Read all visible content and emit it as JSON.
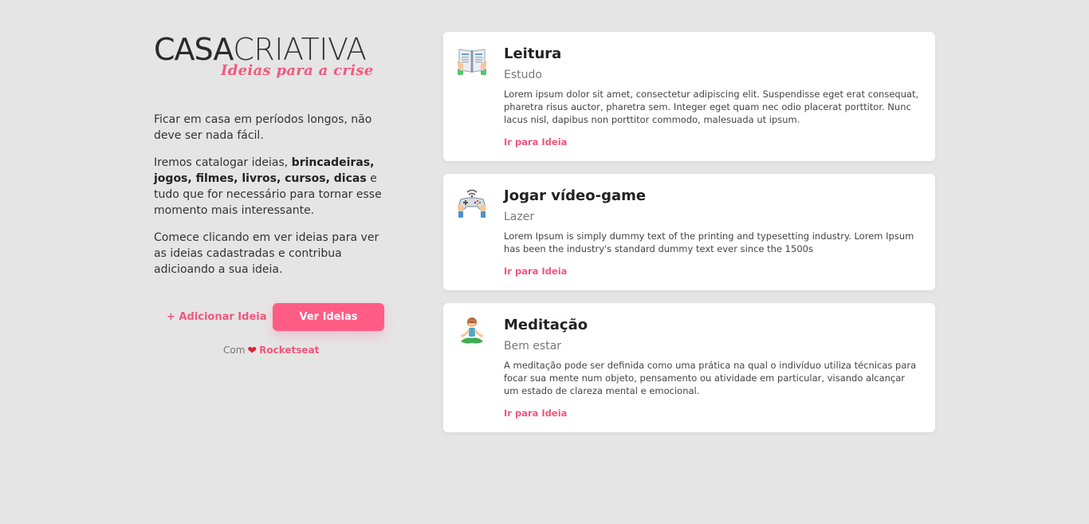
{
  "logo": {
    "main_bold": "CASA",
    "main_light": "CRIATIVA",
    "tagline": "Ideias para a crise"
  },
  "intro": {
    "p1": "Ficar em casa em períodos longos, não deve ser nada fácil.",
    "p2_prefix": "Iremos catalogar ideias, ",
    "p2_bold": "brincadeiras, jogos, filmes, livros, cursos, dicas",
    "p2_suffix": " e tudo que for necessário para tornar esse momento mais interessante.",
    "p3": "Comece clicando em ver ideias para ver as ideias cadastradas e contribua adicioando a sua ideia."
  },
  "actions": {
    "add_label": "+ Adicionar Ideia",
    "view_label": "Ver Ideias"
  },
  "credit": {
    "prefix": "Com",
    "heart": "❤",
    "brand": "Rocketseat"
  },
  "colors": {
    "accent": "#ff5c85",
    "accent_text": "#f0577c",
    "background": "#e5e5e5",
    "card": "#ffffff"
  },
  "cards": [
    {
      "icon": "book-icon",
      "title": "Leitura",
      "category": "Estudo",
      "description": "Lorem ipsum dolor sit amet, consectetur adipiscing elit. Suspendisse eget erat consequat, pharetra risus auctor, pharetra sem. Integer eget quam nec odio placerat porttitor. Nunc lacus nisl, dapibus non porttitor commodo, malesuada ut ipsum.",
      "link": "Ir para Ideia"
    },
    {
      "icon": "gamepad-icon",
      "title": "Jogar vídeo-game",
      "category": "Lazer",
      "description": "Lorem Ipsum is simply dummy text of the printing and typesetting industry. Lorem Ipsum has been the industry's standard dummy text ever since the 1500s",
      "link": "Ir para Ideia"
    },
    {
      "icon": "meditation-icon",
      "title": "Meditação",
      "category": "Bem estar",
      "description": "A meditação pode ser definida como uma prática na qual o indivíduo utiliza técnicas para focar sua mente num objeto, pensamento ou atividade em particular, visando alcançar um estado de clareza mental e emocional.",
      "link": "Ir para Ideia"
    }
  ]
}
